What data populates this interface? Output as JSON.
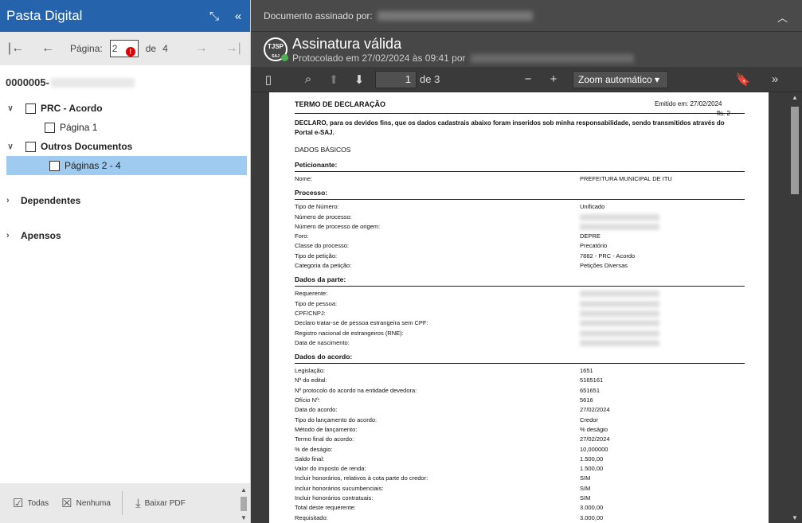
{
  "left": {
    "title": "Pasta Digital",
    "collapse_icon": "compress-icon",
    "hide_icon": "double-chevron-left-icon",
    "pager": {
      "label": "Página:",
      "current": "2",
      "of": "de",
      "total": "4"
    },
    "process_prefix": "0000005-",
    "tree": [
      {
        "label": "PRC - Acordo",
        "children": [
          {
            "label": "Página 1"
          }
        ]
      },
      {
        "label": "Outros Documentos",
        "children": [
          {
            "label": "Páginas 2 - 4"
          }
        ]
      }
    ],
    "sections": [
      "Dependentes",
      "Apensos"
    ],
    "footer": {
      "all": "Todas",
      "none": "Nenhuma",
      "download": "Baixar PDF"
    }
  },
  "signature": {
    "signed_by": "Documento assinado por:",
    "status": "Assinatura válida",
    "protocol": "Protocolado em 27/02/2024 às 09:41 por",
    "seal": "TJSP\nSAJ"
  },
  "viewer": {
    "page": "1",
    "of": "de 3",
    "zoom": "Zoom automático"
  },
  "document": {
    "title": "TERMO DE DECLARAÇÃO",
    "emitted": "Emitido em:   27/02/2024",
    "folio": "fls. 2",
    "declaration1": "DECLARO, para os devidos fins, que os dados cadastrais abaixo foram inseridos sob minha responsabilidade, sendo transmitidos através do",
    "declaration2": "Portal e-SAJ.",
    "basic": "DADOS BÁSICOS",
    "peticionante": {
      "title": "Peticionante:",
      "rows": [
        {
          "k": "Nome:",
          "v": "PREFEITURA MUNICIPAL DE ITU"
        }
      ]
    },
    "processo": {
      "title": "Processo:",
      "rows": [
        {
          "k": "Tipo de Número:",
          "v": "Unificado"
        },
        {
          "k": "Número de processo:",
          "v": ""
        },
        {
          "k": "Número de processo de origem:",
          "v": ""
        },
        {
          "k": "Foro:",
          "v": "DEPRE"
        },
        {
          "k": "Classe do processo:",
          "v": "Precatório"
        },
        {
          "k": "Tipo de petição:",
          "v": "7882 - PRC - Acordo"
        },
        {
          "k": "Categoria da petição:",
          "v": "Petições Diversas"
        }
      ]
    },
    "parte": {
      "title": "Dados da parte:",
      "rows": [
        {
          "k": "Requerente:",
          "v": ""
        },
        {
          "k": "Tipo de pessoa:",
          "v": ""
        },
        {
          "k": "CPF/CNPJ:",
          "v": ""
        },
        {
          "k": "Declaro tratar-se de pessoa estrangeira sem CPF:",
          "v": ""
        },
        {
          "k": "Registro nacional de estrangeiros (RNE):",
          "v": ""
        },
        {
          "k": "Data de nascimento:",
          "v": ""
        }
      ]
    },
    "acordo": {
      "title": "Dados do acordo:",
      "rows": [
        {
          "k": "Legislação:",
          "v": "1651"
        },
        {
          "k": "Nº do edital:",
          "v": "5165161"
        },
        {
          "k": "Nº protocolo do acordo na entidade devedora:",
          "v": "651651"
        },
        {
          "k": "Ofício Nº:",
          "v": "5616"
        },
        {
          "k": "Data do acordo:",
          "v": "27/02/2024"
        },
        {
          "k": "Tipo do lançamento do acordo:",
          "v": "Credor"
        },
        {
          "k": "Método de lançamento:",
          "v": "% deságio"
        },
        {
          "k": "Termo final do acordo:",
          "v": "27/02/2024"
        },
        {
          "k": "% de deságio:",
          "v": "10,000000"
        },
        {
          "k": "Saldo final:",
          "v": "1.500,00"
        },
        {
          "k": "Valor do imposto de renda:",
          "v": "1.500,00"
        },
        {
          "k": "Incluir honorários, relativos à cota parte do credor:",
          "v": "SIM"
        },
        {
          "k": "Incluir honorários sucumbenciais:",
          "v": "SIM"
        },
        {
          "k": "Incluir honorários contratuais:",
          "v": "SIM"
        },
        {
          "k": "Total deste requerente:",
          "v": "3.000,00"
        },
        {
          "k": "Requisitado:",
          "v": "3.000,00"
        }
      ]
    }
  }
}
